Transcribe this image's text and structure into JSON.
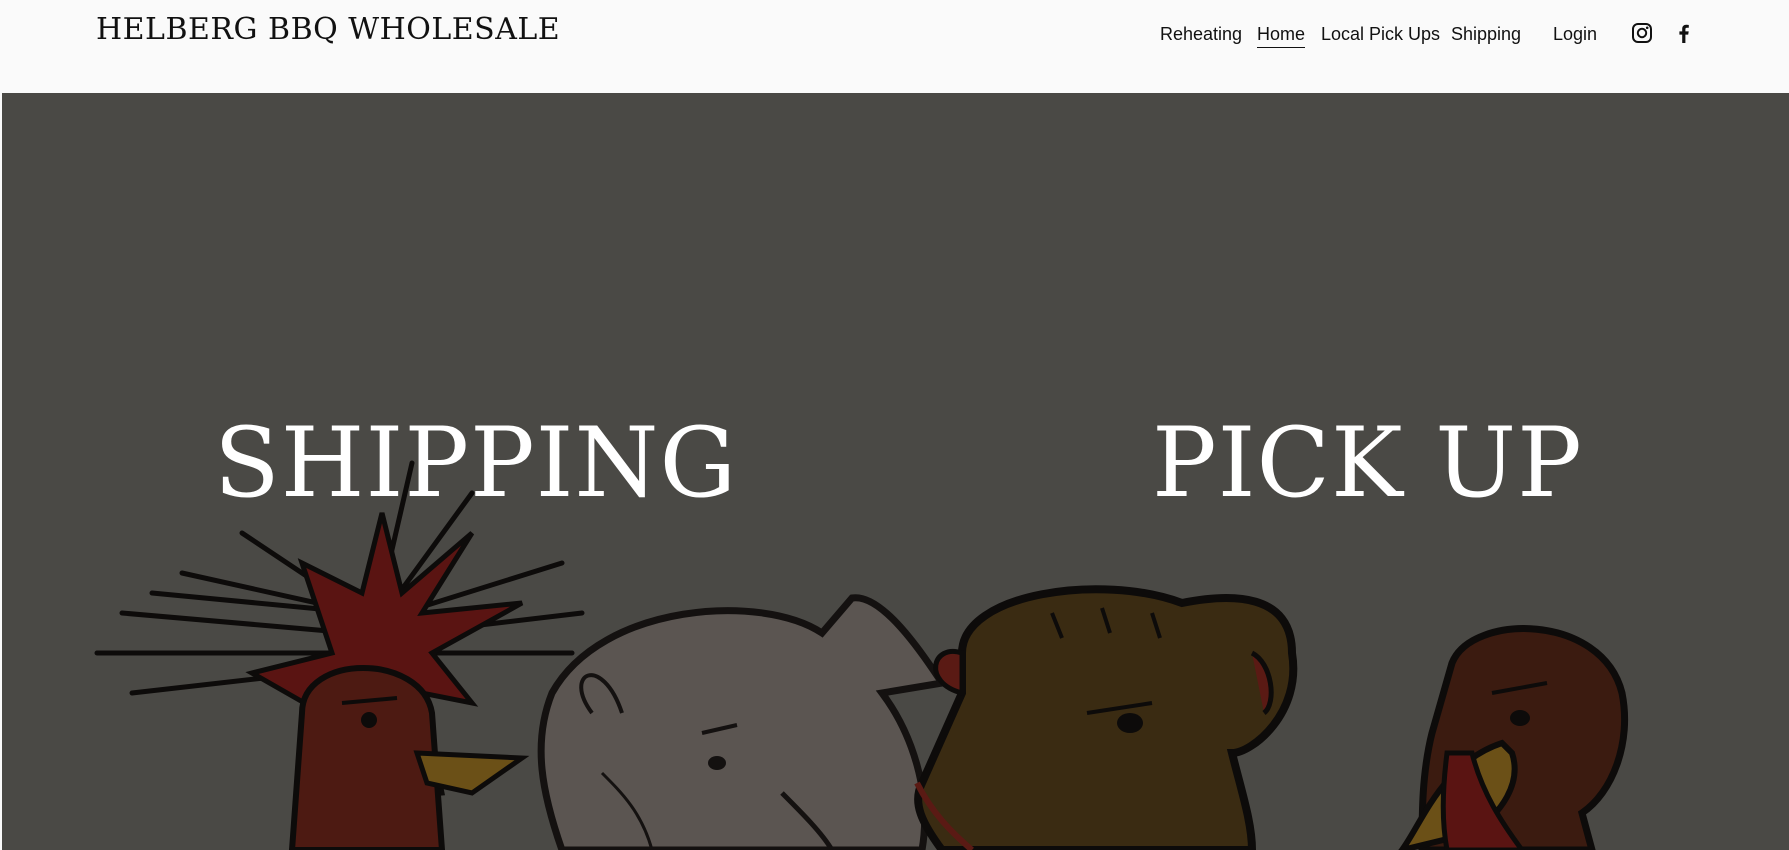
{
  "header": {
    "site_title": "HELBERG BBQ WHOLESALE",
    "nav": {
      "reheating": "Reheating",
      "home": "Home",
      "local_pick_ups": "Local Pick Ups",
      "shipping": "Shipping",
      "login": "Login"
    },
    "social": [
      "instagram-icon",
      "facebook-icon"
    ]
  },
  "hero": {
    "shipping_label": "SHIPPING",
    "pickup_label": "PICK UP",
    "background_color": "#4a4945",
    "illustration": [
      "rooster",
      "pig",
      "cow",
      "turkey"
    ]
  }
}
